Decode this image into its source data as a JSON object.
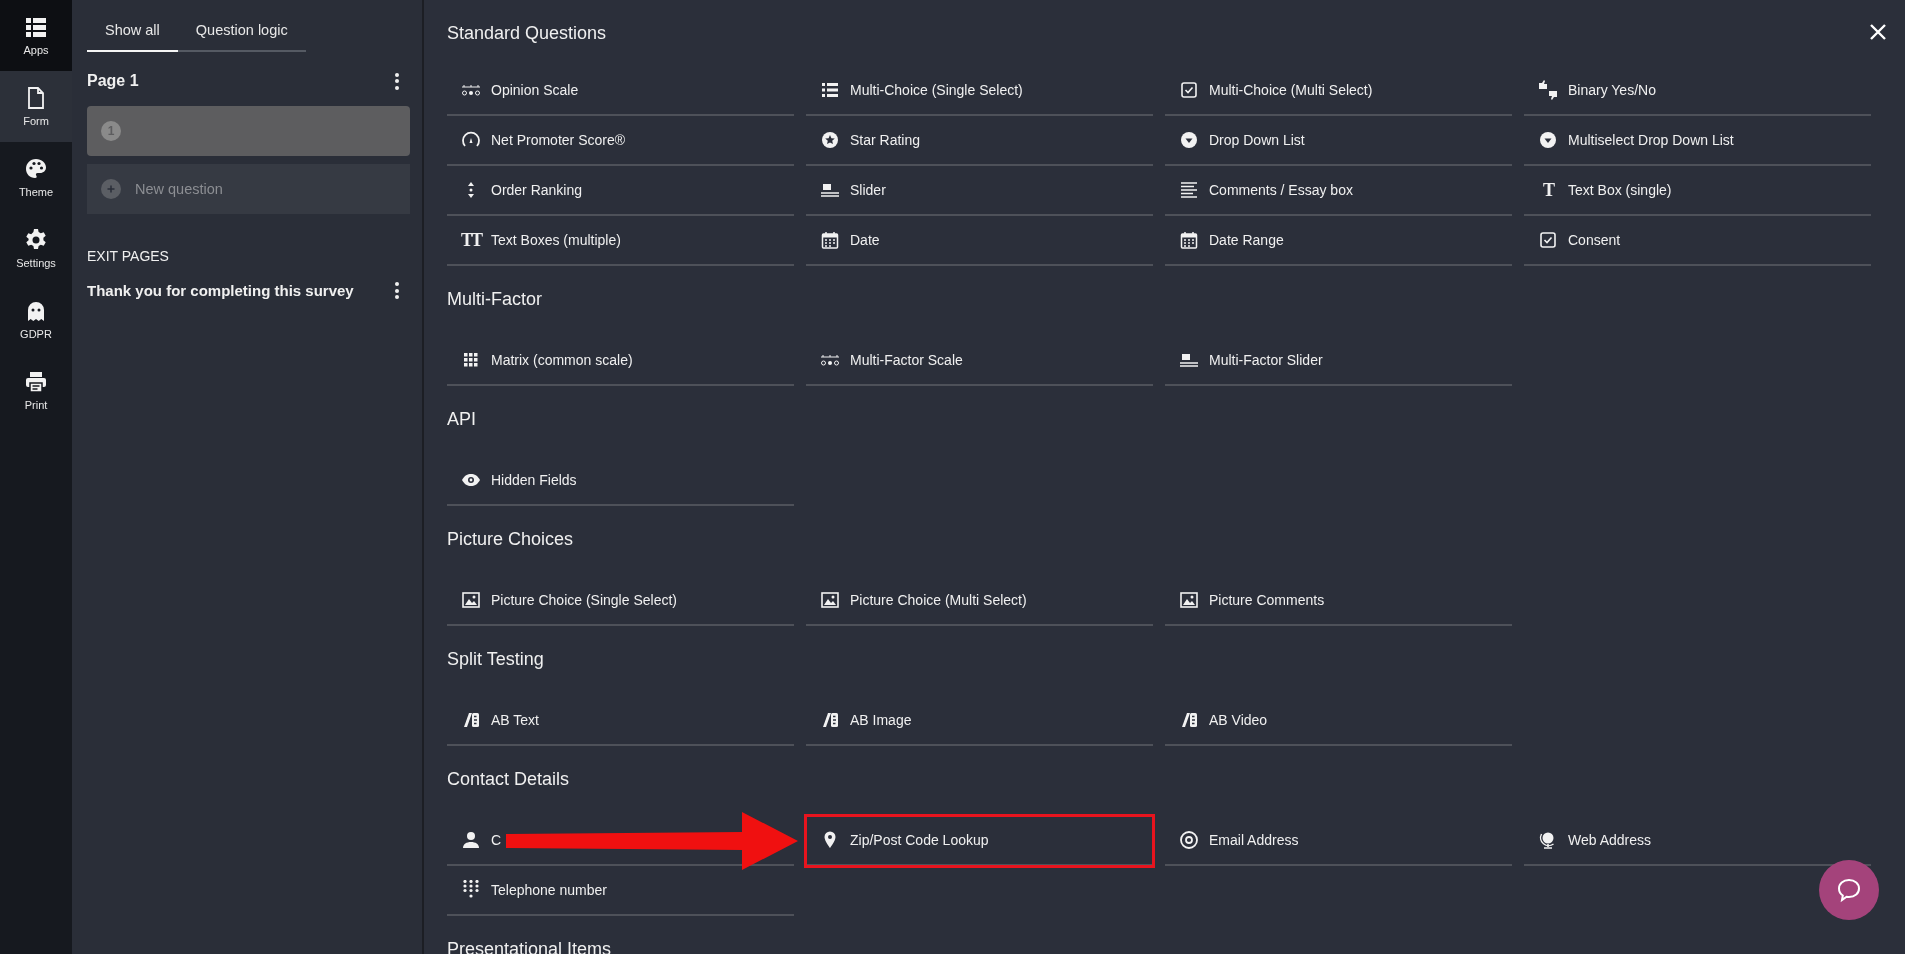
{
  "rail": [
    {
      "label": "Apps",
      "kind": "apps",
      "selected": false
    },
    {
      "label": "Form",
      "kind": "form",
      "selected": true
    },
    {
      "label": "Theme",
      "kind": "theme",
      "selected": false
    },
    {
      "label": "Settings",
      "kind": "settings",
      "selected": false
    },
    {
      "label": "GDPR",
      "kind": "gdpr",
      "selected": false
    },
    {
      "label": "Print",
      "kind": "print",
      "selected": false
    }
  ],
  "tabs": [
    {
      "label": "Show all",
      "selected": true
    },
    {
      "label": "Question logic",
      "selected": false
    }
  ],
  "page": {
    "title": "Page 1",
    "question_number": "1",
    "new_question": "New question"
  },
  "exit_pages": {
    "heading": "EXIT PAGES",
    "items": [
      "Thank you for completing this survey"
    ]
  },
  "sections": [
    {
      "title": "Standard Questions",
      "items": [
        {
          "label": "Opinion Scale",
          "kind": "scale"
        },
        {
          "label": "Multi-Choice (Single Select)",
          "kind": "list"
        },
        {
          "label": "Multi-Choice (Multi Select)",
          "kind": "checkbox"
        },
        {
          "label": "Binary Yes/No",
          "kind": "thumbs"
        },
        {
          "label": "Net Promoter Score®",
          "kind": "gauge"
        },
        {
          "label": "Star Rating",
          "kind": "star"
        },
        {
          "label": "Drop Down List",
          "kind": "dropdown"
        },
        {
          "label": "Multiselect Drop Down List",
          "kind": "dropdown"
        },
        {
          "label": "Order Ranking",
          "kind": "ranking"
        },
        {
          "label": "Slider",
          "kind": "slider"
        },
        {
          "label": "Comments / Essay box",
          "kind": "essay"
        },
        {
          "label": "Text Box (single)",
          "kind": "glyph",
          "glyph": "T"
        },
        {
          "label": "Text Boxes (multiple)",
          "kind": "glyph",
          "glyph": "TT"
        },
        {
          "label": "Date",
          "kind": "date"
        },
        {
          "label": "Date Range",
          "kind": "date"
        },
        {
          "label": "Consent",
          "kind": "checkbox"
        }
      ]
    },
    {
      "title": "Multi-Factor",
      "items": [
        {
          "label": "Matrix (common scale)",
          "kind": "matrix"
        },
        {
          "label": "Multi-Factor Scale",
          "kind": "scale"
        },
        {
          "label": "Multi-Factor Slider",
          "kind": "slider"
        }
      ]
    },
    {
      "title": "API",
      "items": [
        {
          "label": "Hidden Fields",
          "kind": "hidden"
        }
      ]
    },
    {
      "title": "Picture Choices",
      "items": [
        {
          "label": "Picture Choice (Single Select)",
          "kind": "picture"
        },
        {
          "label": "Picture Choice (Multi Select)",
          "kind": "picture"
        },
        {
          "label": "Picture Comments",
          "kind": "picture"
        }
      ]
    },
    {
      "title": "Split Testing",
      "items": [
        {
          "label": "AB Text",
          "kind": "ab"
        },
        {
          "label": "AB Image",
          "kind": "ab"
        },
        {
          "label": "AB Video",
          "kind": "ab"
        }
      ]
    },
    {
      "title": "Contact Details",
      "items": [
        {
          "label": "C",
          "kind": "contact"
        },
        {
          "label": "Zip/Post Code Lookup",
          "kind": "zip",
          "annotated": true
        },
        {
          "label": "Email Address",
          "kind": "email"
        },
        {
          "label": "Web Address",
          "kind": "web"
        },
        {
          "label": "Telephone number",
          "kind": "phone"
        }
      ]
    },
    {
      "title": "Presentational Items"
    }
  ]
}
